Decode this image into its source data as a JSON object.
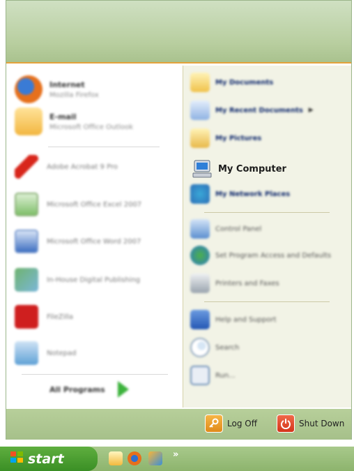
{
  "pinned": [
    {
      "name": "Internet",
      "sub": "Mozilla Firefox"
    },
    {
      "name": "E-mail",
      "sub": "Microsoft Office Outlook"
    }
  ],
  "recent": [
    {
      "label": "Adobe Acrobat 9 Pro"
    },
    {
      "label": "Microsoft Office Excel 2007"
    },
    {
      "label": "Microsoft Office Word 2007"
    },
    {
      "label": "In-House Digital Publishing"
    },
    {
      "label": "FileZilla"
    },
    {
      "label": "Notepad"
    }
  ],
  "all_programs": "All Programs",
  "right_items": [
    {
      "label": "My Documents"
    },
    {
      "label": "My Recent Documents"
    },
    {
      "label": "My Pictures"
    },
    {
      "label": "My Computer"
    },
    {
      "label": "My Network Places"
    },
    {
      "label": "Control Panel"
    },
    {
      "label": "Set Program Access and Defaults"
    },
    {
      "label": "Printers and Faxes"
    },
    {
      "label": "Help and Support"
    },
    {
      "label": "Search"
    },
    {
      "label": "Run..."
    }
  ],
  "footer": {
    "log_off": "Log Off",
    "shut_down": "Shut Down"
  },
  "taskbar": {
    "start": "start",
    "more": "»"
  }
}
